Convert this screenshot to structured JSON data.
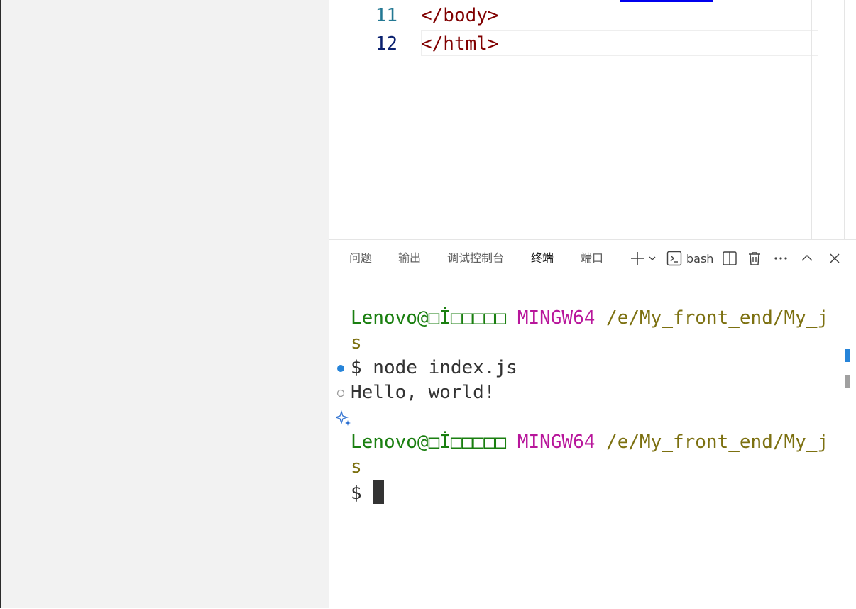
{
  "editor": {
    "lines": [
      {
        "number": "11",
        "code": "</body>"
      },
      {
        "number": "12",
        "code": "</html>"
      }
    ]
  },
  "panel": {
    "tabs": [
      {
        "label": "问题"
      },
      {
        "label": "输出"
      },
      {
        "label": "调试控制台"
      },
      {
        "label": "终端",
        "active": true
      },
      {
        "label": "端口"
      }
    ],
    "terminal_profile": "bash"
  },
  "terminal": {
    "prompt1": {
      "user": "Lenovo@□İ□□□□□",
      "system": "MINGW64",
      "path": "/e/My_front_end/My_j",
      "path_wrap": "s"
    },
    "command": "$ node index.js",
    "output": "Hello, world!",
    "prompt2": {
      "user": "Lenovo@□İ□□□□□",
      "system": "MINGW64",
      "path": "/e/My_front_end/My_j",
      "path_wrap": "s"
    },
    "dollar": "$"
  },
  "colors": {
    "user": "#1a7f10",
    "system": "#b8169b",
    "path": "#7c7010",
    "success_decoration": "#2684d9"
  }
}
